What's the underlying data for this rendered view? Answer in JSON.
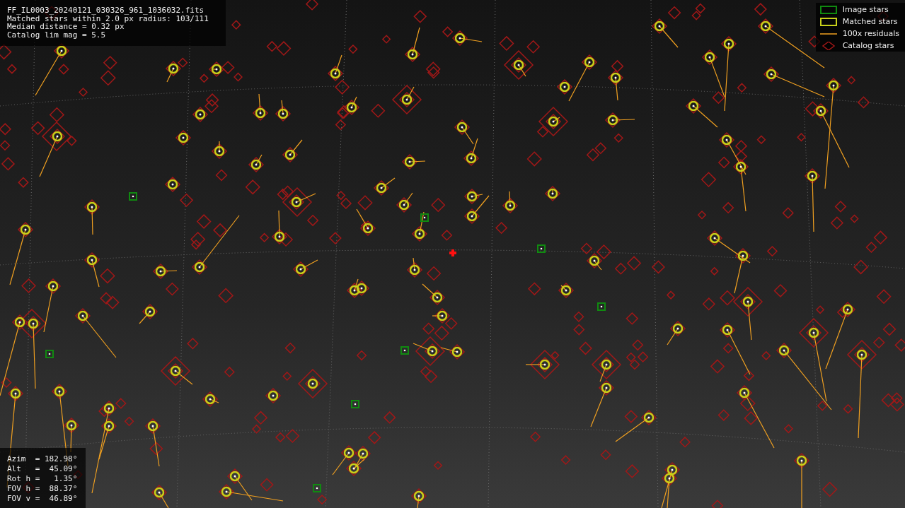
{
  "info_lines": [
    "FF_IL0003_20240121_030326_961_1036032.fits",
    "Matched stars within 2.0 px radius: 103/111",
    "Median distance = 0.32 px",
    "Catalog lim mag = 5.5"
  ],
  "legend": [
    {
      "kind": "image",
      "label": "Image stars"
    },
    {
      "kind": "matched",
      "label": "Matched stars"
    },
    {
      "kind": "residual",
      "label": "100x residuals"
    },
    {
      "kind": "catalog",
      "label": "Catalog stars"
    }
  ],
  "pointing": [
    "Azim  = 182.98°",
    "Alt   =  45.09°",
    "Rot h =   1.35°",
    "FOV h =  88.37°",
    "FOV v =  46.89°"
  ]
}
